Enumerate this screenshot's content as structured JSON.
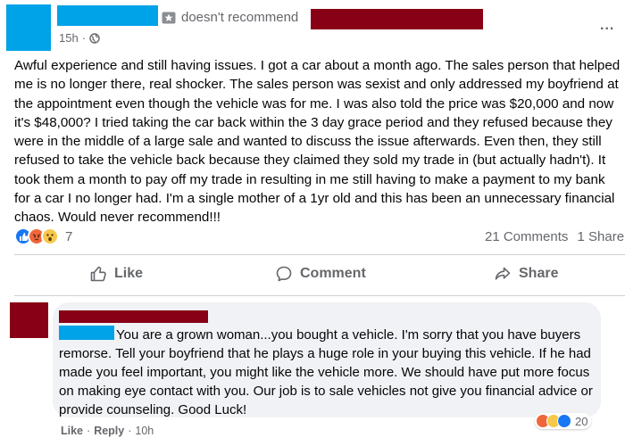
{
  "post": {
    "recommendation": "doesn't recommend",
    "timestamp": "15h",
    "more": "...",
    "body": "Awful experience and still having issues. I got a car about a month ago. The sales person that helped me is no longer there, real shocker. The sales person was sexist and only addressed my boyfriend at the appointment even though the vehicle was for me. I was also told the price was $20,000 and now it's $48,000? I tried taking the car back within the 3 day grace period and they refused because they were in the middle of a large sale and wanted to discuss the issue afterwards. Even then, they still refused to take the vehicle back because they claimed they sold my trade in (but actually hadn't). It took them a month to pay off my trade in resulting in me still having to make a payment to my bank for a car I no longer had. I'm a single mother of a 1yr old and this has been an unnecessary financial chaos. Would never recommend!!!",
    "reaction_count": "7",
    "comments_count": "21 Comments",
    "shares_count": "1 Share",
    "reaction_icons": [
      "like-icon",
      "angry-icon",
      "wow-icon"
    ]
  },
  "actions": {
    "like": "Like",
    "comment": "Comment",
    "share": "Share"
  },
  "comment": {
    "text": "You are a grown woman...you bought a vehicle. I'm sorry that you have buyers remorse. Tell your boyfriend that he plays a huge role in your buying this vehicle. If he had made you feel important, you might like the vehicle more. We should have put more focus on making eye contact with you. Our job is to sale vehicles not give you financial advice or provide counseling. Good Luck!",
    "reaction_count": "20",
    "reaction_icons": [
      "angry-icon",
      "wow-icon",
      "like-icon"
    ],
    "like_label": "Like",
    "separator": "·",
    "reply_label": "Reply",
    "time": "10h"
  },
  "colors": {
    "redaction_blue": "#00a2e8",
    "redaction_maroon": "#880015",
    "like_blue": "#1877f2",
    "angry_orange": "#f0663a",
    "wow_yellow": "#f7c94a",
    "secondary_text": "#65676b"
  }
}
